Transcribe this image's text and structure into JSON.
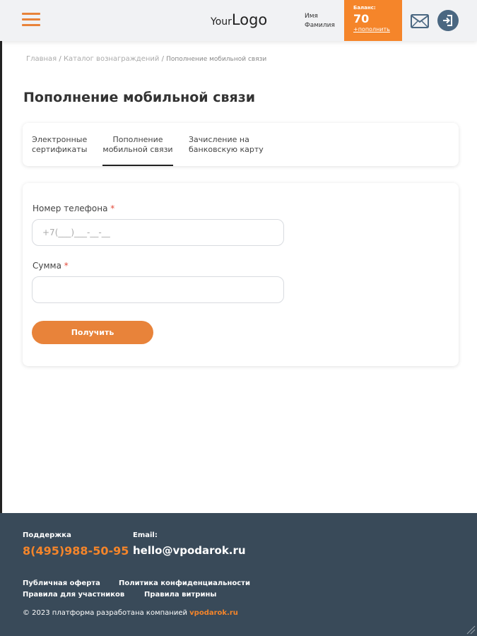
{
  "header": {
    "logo_your": "Your",
    "logo_big": "Logo",
    "user_first": "Имя",
    "user_last": "Фамилия",
    "balance_label": "Баланс:",
    "balance_amount": "70",
    "balance_topup": "+пополнить"
  },
  "breadcrumb": {
    "home": "Главная",
    "catalog": "Каталог вознаграждений",
    "current": "Пополнение мобильной связи",
    "sep": " / "
  },
  "page": {
    "title": "Пополнение мобильной связи"
  },
  "tabs": [
    {
      "line1": "Электронные",
      "line2": "сертификаты"
    },
    {
      "line1": "Пополнение",
      "line2": "мобильной связи"
    },
    {
      "line1": "Зачисление на",
      "line2": "банковскую карту"
    }
  ],
  "form": {
    "phone_label": "Номер телефона",
    "phone_placeholder": "+7(___)___-__-__",
    "amount_label": "Сумма",
    "required_mark": "*",
    "submit_label": "Получить"
  },
  "footer": {
    "support_label": "Поддержка",
    "phone": "8(495)988-50-95",
    "email_label": "Email:",
    "email": "hello@vpodarok.ru",
    "links": {
      "offer": "Публичная оферта",
      "privacy": "Политика конфиденциальности",
      "rules_participants": "Правила для участников",
      "rules_showcase": "Правила витрины"
    },
    "copyright_text": "© 2023 платформа разработана компанией ",
    "copyright_brand": "vpodarok.ru"
  },
  "colors": {
    "accent": "#f5852a",
    "button": "#e8833a",
    "footer_bg": "#394a59",
    "login_icon": "#4a6781",
    "required": "#e34b3b"
  },
  "icons": [
    "hamburger-menu-icon",
    "mail-icon",
    "login-icon"
  ]
}
